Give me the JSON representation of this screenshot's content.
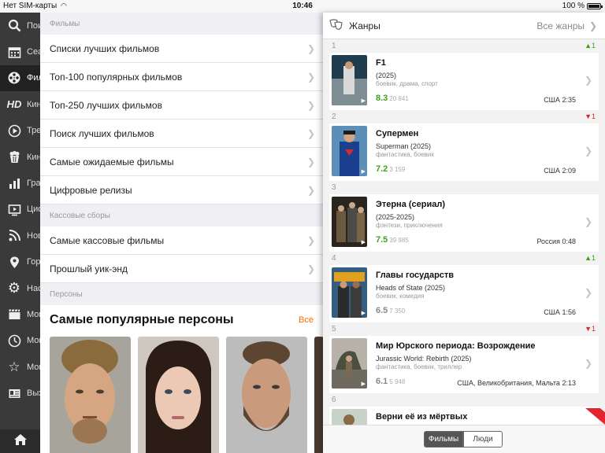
{
  "status": {
    "carrier": "Нет SIM-карты",
    "time": "10:46",
    "battery": "100 %"
  },
  "sidenav": {
    "items": [
      {
        "label": "Поиск",
        "icon": "search-icon"
      },
      {
        "label": "Сеансы",
        "icon": "calendar-icon"
      },
      {
        "label": "Фильмы",
        "icon": "film-reel-icon"
      },
      {
        "label": "Кино HD",
        "icon": "hd-icon"
      },
      {
        "label": "Трейлеры",
        "icon": "play-icon"
      },
      {
        "label": "Кинотеатры",
        "icon": "popcorn-icon"
      },
      {
        "label": "Графики",
        "icon": "chart-icon"
      },
      {
        "label": "Цифровые",
        "icon": "tv-icon"
      },
      {
        "label": "Новости",
        "icon": "rss-icon"
      },
      {
        "label": "Город",
        "icon": "location-pin-icon"
      },
      {
        "label": "Настройки",
        "icon": "gear-icon"
      },
      {
        "label": "Мои фильмы",
        "icon": "clapperboard-icon"
      },
      {
        "label": "Мои сеансы",
        "icon": "clock-icon"
      },
      {
        "label": "Мои оценки",
        "icon": "star-icon"
      },
      {
        "label": "Выход",
        "icon": "id-card-icon"
      }
    ],
    "home_icon": "home-icon"
  },
  "mid": {
    "section_films": "Фильмы",
    "films_rows": [
      "Списки лучших фильмов",
      "Топ-100 популярных фильмов",
      "Топ-250 лучших фильмов",
      "Поиск лучших фильмов",
      "Самые ожидаемые фильмы",
      "Цифровые релизы"
    ],
    "section_boxoffice": "Кассовые сборы",
    "boxoffice_rows": [
      "Самые кассовые фильмы",
      "Прошлый уик-энд"
    ],
    "section_persons": "Персоны",
    "persons_title": "Самые популярные персоны",
    "persons_all": "Все"
  },
  "genres": {
    "title": "Жанры",
    "all_label": "Все жанры",
    "movies": [
      {
        "rank": "1",
        "delta": "▲1",
        "dir": "up",
        "title": "F1",
        "sub": "(2025)",
        "genres": "боевик, драма, спорт",
        "rating": "8.3",
        "votes": "20 841",
        "country": "США",
        "duration": "2:35",
        "rating_color": "green"
      },
      {
        "rank": "2",
        "delta": "▼1",
        "dir": "down",
        "title": "Супермен",
        "sub": "Superman (2025)",
        "genres": "фантастика, боевик",
        "rating": "7.2",
        "votes": "3 159",
        "country": "США",
        "duration": "2:09",
        "rating_color": "green"
      },
      {
        "rank": "3",
        "delta": "",
        "dir": "none",
        "title": "Этерна (сериал)",
        "sub": "(2025-2025)",
        "genres": "фэнтези, приключения",
        "rating": "7.5",
        "votes": "39 985",
        "country": "Россия",
        "duration": "0:48",
        "rating_color": "green"
      },
      {
        "rank": "4",
        "delta": "▲1",
        "dir": "up",
        "title": "Главы государств",
        "sub": "Heads of State (2025)",
        "genres": "боевик, комедия",
        "rating": "6.5",
        "votes": "7 350",
        "country": "США",
        "duration": "1:56",
        "rating_color": "grey"
      },
      {
        "rank": "5",
        "delta": "▼1",
        "dir": "down",
        "title": "Мир Юрского периода: Возрождение",
        "sub": "Jurassic World: Rebirth (2025)",
        "genres": "фантастика, боевик, триллер",
        "rating": "6.1",
        "votes": "5 948",
        "country": "США, Великобритания, Мальта",
        "duration": "2:13",
        "rating_color": "grey"
      },
      {
        "rank": "6",
        "delta": "",
        "dir": "none",
        "title": "Верни её из мёртвых",
        "sub": "",
        "genres": "",
        "rating": "",
        "votes": "",
        "country": "",
        "duration": "",
        "rating_color": "grey"
      }
    ],
    "seg_films": "Фильмы",
    "seg_people": "Люди"
  },
  "colors": {
    "accent_orange": "#ff6a00",
    "rating_green": "#3f9f1b",
    "rating_grey": "#888888",
    "delta_up": "#3f9f1b",
    "delta_down": "#d12b2b"
  }
}
